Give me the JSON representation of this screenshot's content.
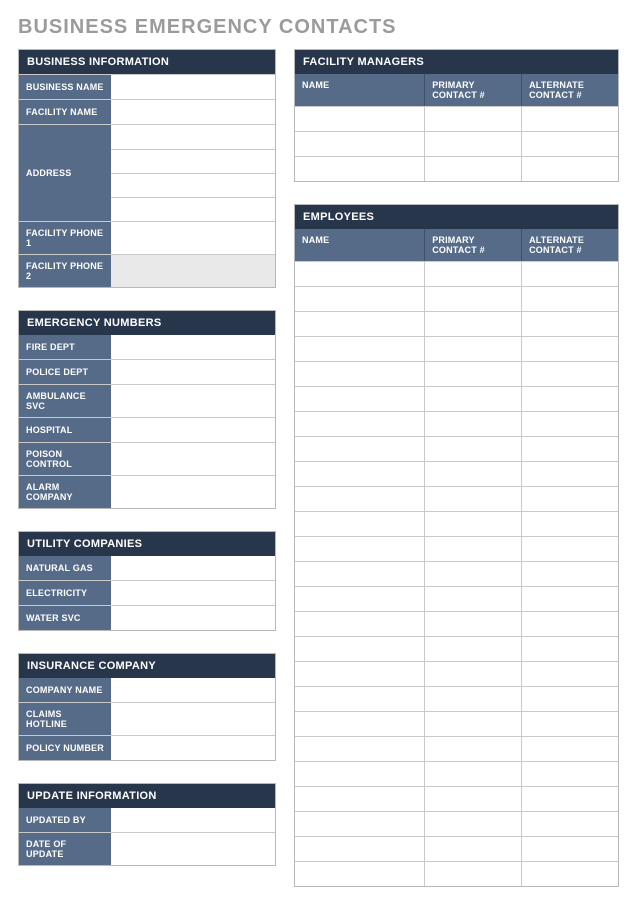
{
  "title": "BUSINESS EMERGENCY CONTACTS",
  "business_info": {
    "header": "BUSINESS INFORMATION",
    "labels": {
      "business_name": "BUSINESS NAME",
      "facility_name": "FACILITY NAME",
      "address": "ADDRESS",
      "facility_phone1": "FACILITY PHONE 1",
      "facility_phone2": "FACILITY PHONE 2"
    },
    "values": {
      "business_name": "",
      "facility_name": "",
      "address": [
        "",
        "",
        "",
        ""
      ],
      "facility_phone1": "",
      "facility_phone2": ""
    }
  },
  "emergency_numbers": {
    "header": "EMERGENCY NUMBERS",
    "rows": [
      {
        "label": "FIRE DEPT",
        "value": ""
      },
      {
        "label": "POLICE DEPT",
        "value": ""
      },
      {
        "label": "AMBULANCE SVC",
        "value": ""
      },
      {
        "label": "HOSPITAL",
        "value": ""
      },
      {
        "label": "POISON CONTROL",
        "value": ""
      },
      {
        "label": "ALARM COMPANY",
        "value": ""
      }
    ]
  },
  "utility_companies": {
    "header": "UTILITY COMPANIES",
    "rows": [
      {
        "label": "NATURAL GAS",
        "value": ""
      },
      {
        "label": "ELECTRICITY",
        "value": ""
      },
      {
        "label": "WATER SVC",
        "value": ""
      }
    ]
  },
  "insurance_company": {
    "header": "INSURANCE COMPANY",
    "rows": [
      {
        "label": "COMPANY NAME",
        "value": ""
      },
      {
        "label": "CLAIMS HOTLINE",
        "value": ""
      },
      {
        "label": "POLICY NUMBER",
        "value": ""
      }
    ]
  },
  "update_information": {
    "header": "UPDATE INFORMATION",
    "rows": [
      {
        "label": "UPDATED BY",
        "value": ""
      },
      {
        "label": "DATE OF UPDATE",
        "value": ""
      }
    ]
  },
  "facility_managers": {
    "header": "FACILITY MANAGERS",
    "columns": {
      "name": "NAME",
      "primary": "PRIMARY CONTACT #",
      "alternate": "ALTERNATE CONTACT #"
    },
    "rows": [
      {
        "name": "",
        "primary": "",
        "alternate": ""
      },
      {
        "name": "",
        "primary": "",
        "alternate": ""
      },
      {
        "name": "",
        "primary": "",
        "alternate": ""
      }
    ]
  },
  "employees": {
    "header": "EMPLOYEES",
    "columns": {
      "name": "NAME",
      "primary": "PRIMARY CONTACT #",
      "alternate": "ALTERNATE CONTACT #"
    },
    "rows": [
      {
        "name": "",
        "primary": "",
        "alternate": ""
      },
      {
        "name": "",
        "primary": "",
        "alternate": ""
      },
      {
        "name": "",
        "primary": "",
        "alternate": ""
      },
      {
        "name": "",
        "primary": "",
        "alternate": ""
      },
      {
        "name": "",
        "primary": "",
        "alternate": ""
      },
      {
        "name": "",
        "primary": "",
        "alternate": ""
      },
      {
        "name": "",
        "primary": "",
        "alternate": ""
      },
      {
        "name": "",
        "primary": "",
        "alternate": ""
      },
      {
        "name": "",
        "primary": "",
        "alternate": ""
      },
      {
        "name": "",
        "primary": "",
        "alternate": ""
      },
      {
        "name": "",
        "primary": "",
        "alternate": ""
      },
      {
        "name": "",
        "primary": "",
        "alternate": ""
      },
      {
        "name": "",
        "primary": "",
        "alternate": ""
      },
      {
        "name": "",
        "primary": "",
        "alternate": ""
      },
      {
        "name": "",
        "primary": "",
        "alternate": ""
      },
      {
        "name": "",
        "primary": "",
        "alternate": ""
      },
      {
        "name": "",
        "primary": "",
        "alternate": ""
      },
      {
        "name": "",
        "primary": "",
        "alternate": ""
      },
      {
        "name": "",
        "primary": "",
        "alternate": ""
      },
      {
        "name": "",
        "primary": "",
        "alternate": ""
      },
      {
        "name": "",
        "primary": "",
        "alternate": ""
      },
      {
        "name": "",
        "primary": "",
        "alternate": ""
      },
      {
        "name": "",
        "primary": "",
        "alternate": ""
      },
      {
        "name": "",
        "primary": "",
        "alternate": ""
      },
      {
        "name": "",
        "primary": "",
        "alternate": ""
      }
    ]
  }
}
